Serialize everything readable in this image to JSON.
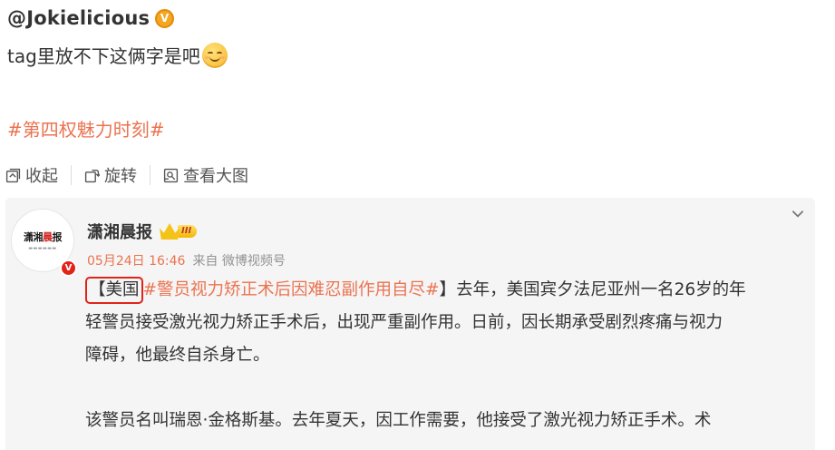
{
  "repost": {
    "username": "@Jokielicious",
    "verified_badge": "V",
    "text": "tag里放不下这俩字是吧",
    "emoji": "smile-blush-icon",
    "topic": "#第四权魅力时刻#"
  },
  "actions": [
    {
      "icon": "collapse-icon",
      "label": "收起"
    },
    {
      "icon": "rotate-icon",
      "label": "旋转"
    },
    {
      "icon": "view-large-icon",
      "label": "查看大图"
    }
  ],
  "card": {
    "author": "潇湘晨报",
    "avatar_logo_black": "潇湘",
    "avatar_logo_red": "晨",
    "avatar_logo_black2": "报",
    "verified_badge": "V",
    "level": "III",
    "timestamp": "05月24日 16:46",
    "source": "来自 微博视频号",
    "bracket_open": "【",
    "boxed_text": "美国",
    "topic": "#警员视力矫正术后因难忍副作用自尽#",
    "bracket_close": "】",
    "line1_rest": "去年，美国宾夕法尼亚州一名26岁的年",
    "line2": "轻警员接受激光视力矫正手术后，出现严重副作用。日前，因长期承受剧烈疼痛与视力",
    "line3": "障碍，他最终自杀身亡。",
    "para2": "该警员名叫瑞恩·金格斯基。去年夏天，因工作需要，他接受了激光视力矫正手术。术"
  },
  "colors": {
    "topic": "#eb7350",
    "highlight_box": "#e2231a",
    "card_bg": "#f5f5f5"
  }
}
